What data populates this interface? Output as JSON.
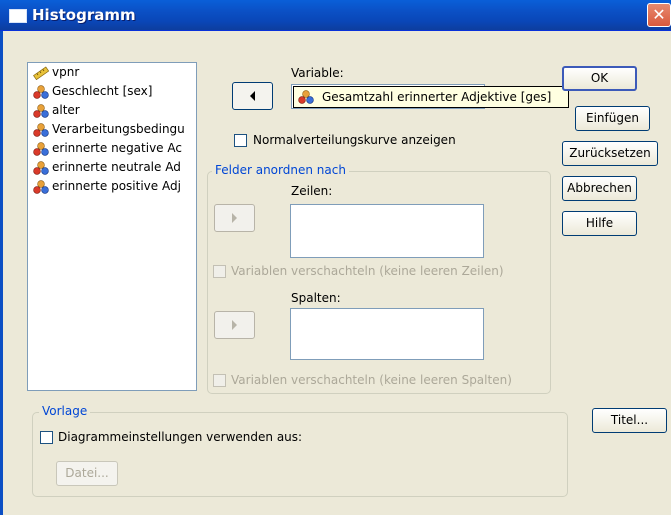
{
  "window": {
    "title": "Histogramm",
    "close_glyph": "✕"
  },
  "source_list": {
    "items": [
      {
        "label": "vpnr",
        "icon": "ruler-icon"
      },
      {
        "label": "Geschlecht [sex]",
        "icon": "nominal-variable-icon"
      },
      {
        "label": "alter",
        "icon": "nominal-variable-icon"
      },
      {
        "label": "Verarbeitungsbedingu",
        "icon": "nominal-variable-icon"
      },
      {
        "label": "erinnerte negative Ac",
        "icon": "nominal-variable-icon"
      },
      {
        "label": "erinnerte neutrale Ad",
        "icon": "nominal-variable-icon"
      },
      {
        "label": "erinnerte positive Adj",
        "icon": "nominal-variable-icon"
      }
    ]
  },
  "variable": {
    "label": "Variable:",
    "tooltip": "Gesamtzahl erinnerter Adjektive [ges]"
  },
  "normal_curve": {
    "label": "Normalverteilungskurve anzeigen",
    "checked": false
  },
  "panels": {
    "legend": "Felder anordnen nach",
    "rows_label": "Zeilen:",
    "rows_nest": "Variablen verschachteln (keine leeren Zeilen)",
    "cols_label": "Spalten:",
    "cols_nest": "Variablen verschachteln (keine leeren Spalten)"
  },
  "template": {
    "legend": "Vorlage",
    "use_label": "Diagrammeinstellungen verwenden aus:",
    "file_button": "Datei..."
  },
  "buttons": {
    "ok": "OK",
    "paste": "Einfügen",
    "reset": "Zurücksetzen",
    "cancel": "Abbrechen",
    "help": "Hilfe",
    "titles": "Titel..."
  },
  "colors": {
    "titlebar": "#0b4fc4",
    "group_legend": "#0046d5",
    "tooltip_bg": "#ffffe1",
    "dialog_bg": "#ece9d8"
  }
}
